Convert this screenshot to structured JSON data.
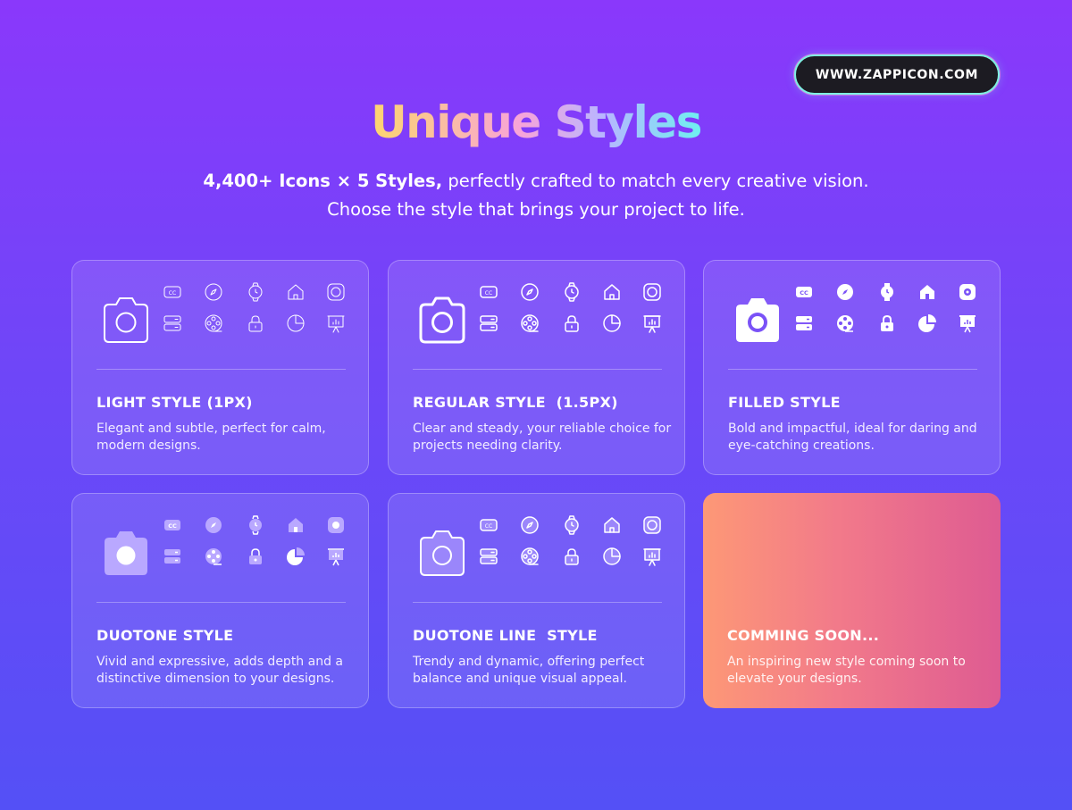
{
  "badge": {
    "label": "WWW.ZAPPICON.COM"
  },
  "header": {
    "title": "Unique Styles",
    "subtitle_bold": "4,400+ Icons × 5 Styles,",
    "subtitle_rest": " perfectly crafted to match every creative vision.",
    "subtitle_line2": "Choose the style that brings your project to life."
  },
  "icons": [
    "camera-icon",
    "cc-icon",
    "compass-icon",
    "watch-icon",
    "home-icon",
    "record-icon",
    "server-icon",
    "film-reel-icon",
    "lock-icon",
    "pie-chart-icon",
    "presentation-icon"
  ],
  "cards": [
    {
      "title": "LIGHT STYLE (1PX)",
      "description": "Elegant and subtle, perfect for calm, modern designs.",
      "style": "light"
    },
    {
      "title": "REGULAR STYLE  (1.5PX)",
      "description": "Clear and steady, your reliable choice for projects needing clarity.",
      "style": "regular"
    },
    {
      "title": "FILLED STYLE",
      "description": "Bold and impactful, ideal for daring and eye-catching creations.",
      "style": "filled"
    },
    {
      "title": "DUOTONE STYLE",
      "description": "Vivid and expressive, adds depth and a distinctive dimension to your designs.",
      "style": "duotone"
    },
    {
      "title": "DUOTONE LINE  STYLE",
      "description": "Trendy and dynamic, offering perfect balance and unique visual appeal.",
      "style": "duotone-line"
    },
    {
      "title": "COMMING SOON...",
      "description": "An inspiring new style coming soon to elevate your designs.",
      "style": "soon"
    }
  ],
  "colors": {
    "background_top": "#8a38fb",
    "background_bottom": "#5450f6",
    "soon_gradient_start": "#fd9876",
    "soon_gradient_end": "#de5b92",
    "duotone_secondary": "#b9a8ff"
  }
}
